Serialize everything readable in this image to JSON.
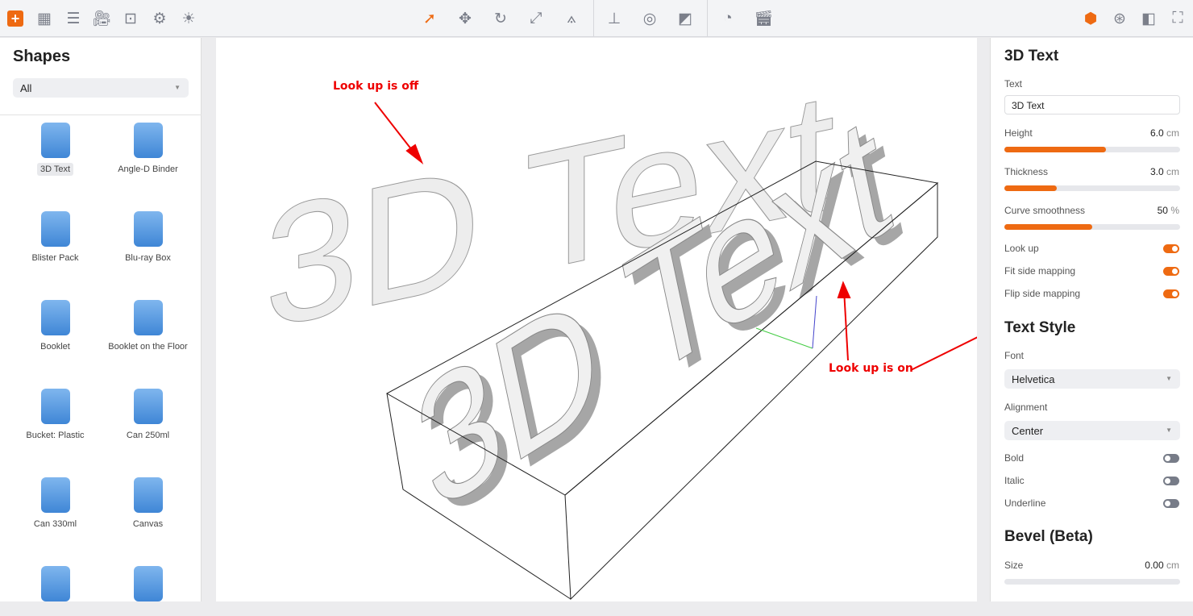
{
  "toolbar": {
    "left_icons": [
      "add-icon",
      "grid-icon",
      "menu-icon",
      "camera-icon",
      "focus-icon",
      "gear-icon",
      "light-icon"
    ],
    "center_icons": [
      "select-arrow-icon",
      "move-icon",
      "rotate-icon",
      "scale-icon",
      "pivot-icon",
      "floor-icon",
      "material-icon",
      "texture-icon",
      "timeline-icon",
      "clapper-icon"
    ],
    "right_icons": [
      "cube-icon",
      "ball-icon",
      "frame-icon",
      "fullscreen-icon"
    ],
    "accent": "#ee6a12"
  },
  "shapes": {
    "title": "Shapes",
    "filter": "All",
    "items": [
      {
        "label": "3D Text",
        "selected": true
      },
      {
        "label": "Angle-D Binder"
      },
      {
        "label": "Blister Pack"
      },
      {
        "label": "Blu-ray Box"
      },
      {
        "label": "Booklet"
      },
      {
        "label": "Booklet on the Floor"
      },
      {
        "label": "Bucket: Plastic"
      },
      {
        "label": "Can 250ml"
      },
      {
        "label": "Can 330ml"
      },
      {
        "label": "Canvas"
      },
      {
        "label": ""
      },
      {
        "label": ""
      }
    ]
  },
  "viewport": {
    "annotation_off": "Look up is off",
    "annotation_on": "Look up is on",
    "scene_text": "3D Text"
  },
  "properties": {
    "title": "3D Text",
    "text_label": "Text",
    "text_value": "3D Text",
    "height_label": "Height",
    "height_value": "6.0",
    "height_unit": "cm",
    "height_fill": 0.58,
    "thickness_label": "Thickness",
    "thickness_value": "3.0",
    "thickness_unit": "cm",
    "thickness_fill": 0.3,
    "smooth_label": "Curve smoothness",
    "smooth_value": "50",
    "smooth_unit": "%",
    "smooth_fill": 0.5,
    "lookup_label": "Look up",
    "lookup_on": true,
    "fit_label": "Fit side mapping",
    "fit_on": true,
    "flip_label": "Flip side mapping",
    "flip_on": true,
    "style_title": "Text Style",
    "font_label": "Font",
    "font_value": "Helvetica",
    "align_label": "Alignment",
    "align_value": "Center",
    "bold_label": "Bold",
    "italic_label": "Italic",
    "underline_label": "Underline",
    "bevel_title": "Bevel (Beta)",
    "size_label": "Size",
    "size_value": "0.00",
    "size_unit": "cm",
    "size_fill": 0
  }
}
